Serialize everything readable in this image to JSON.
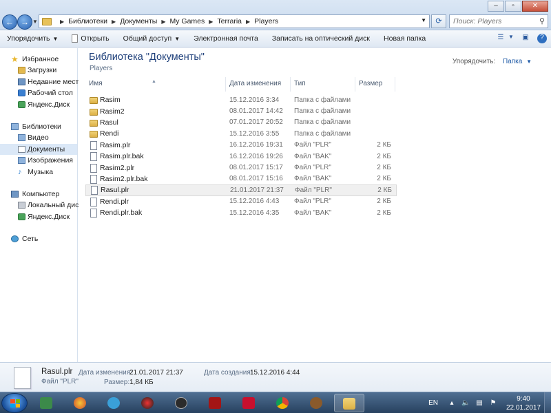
{
  "address": {
    "crumbs": [
      "Библиотеки",
      "Документы",
      "My Games",
      "Terraria",
      "Players"
    ]
  },
  "search": {
    "placeholder": "Поиск: Players"
  },
  "toolbar": {
    "organize": "Упорядочить",
    "open": "Открыть",
    "share": "Общий доступ",
    "email": "Электронная почта",
    "burn": "Записать на оптический диск",
    "new_folder": "Новая папка"
  },
  "nav": {
    "favorites": "Избранное",
    "downloads": "Загрузки",
    "recent": "Недавние места",
    "desktop": "Рабочий стол",
    "yadisk1": "Яндекс.Диск",
    "libraries": "Библиотеки",
    "video": "Видео",
    "documents": "Документы",
    "images": "Изображения",
    "music": "Музыка",
    "computer": "Компьютер",
    "localdisk": "Локальный диск",
    "yadisk2": "Яндекс.Диск",
    "network": "Сеть"
  },
  "library": {
    "title": "Библиотека \"Документы\"",
    "subtitle": "Players",
    "arrange_label": "Упорядочить:",
    "arrange_value": "Папка"
  },
  "columns": {
    "name": "Имя",
    "date": "Дата изменения",
    "type": "Тип",
    "size": "Размер"
  },
  "files": [
    {
      "name": "Rasim",
      "date": "15.12.2016 3:34",
      "type": "Папка с файлами",
      "size": ""
    },
    {
      "name": "Rasim2",
      "date": "08.01.2017 14:42",
      "type": "Папка с файлами",
      "size": ""
    },
    {
      "name": "Rasul",
      "date": "07.01.2017 20:52",
      "type": "Папка с файлами",
      "size": ""
    },
    {
      "name": "Rendi",
      "date": "15.12.2016 3:55",
      "type": "Папка с файлами",
      "size": ""
    },
    {
      "name": "Rasim.plr",
      "date": "16.12.2016 19:31",
      "type": "Файл \"PLR\"",
      "size": "2 КБ"
    },
    {
      "name": "Rasim.plr.bak",
      "date": "16.12.2016 19:26",
      "type": "Файл \"BAK\"",
      "size": "2 КБ"
    },
    {
      "name": "Rasim2.plr",
      "date": "08.01.2017 15:17",
      "type": "Файл \"PLR\"",
      "size": "2 КБ"
    },
    {
      "name": "Rasim2.plr.bak",
      "date": "08.01.2017 15:16",
      "type": "Файл \"BAK\"",
      "size": "2 КБ"
    },
    {
      "name": "Rasul.plr",
      "date": "21.01.2017 21:37",
      "type": "Файл \"PLR\"",
      "size": "2 КБ"
    },
    {
      "name": "Rendi.plr",
      "date": "15.12.2016 4:43",
      "type": "Файл \"PLR\"",
      "size": "2 КБ"
    },
    {
      "name": "Rendi.plr.bak",
      "date": "15.12.2016 4:35",
      "type": "Файл \"BAK\"",
      "size": "2 КБ"
    }
  ],
  "details": {
    "name": "Rasul.plr",
    "type": "Файл \"PLR\"",
    "modified_label": "Дата изменения:",
    "modified_value": "21.01.2017 21:37",
    "size_label": "Размер:",
    "size_value": "1,84 КБ",
    "created_label": "Дата создания:",
    "created_value": "15.12.2016 4:44"
  },
  "taskbar": {
    "lang": "EN",
    "time": "9:40",
    "date": "22.01.2017"
  },
  "colors": {
    "accent": "#1f5aa6",
    "selection": "#dbe8f7",
    "title_blue": "#1e3f7a"
  }
}
